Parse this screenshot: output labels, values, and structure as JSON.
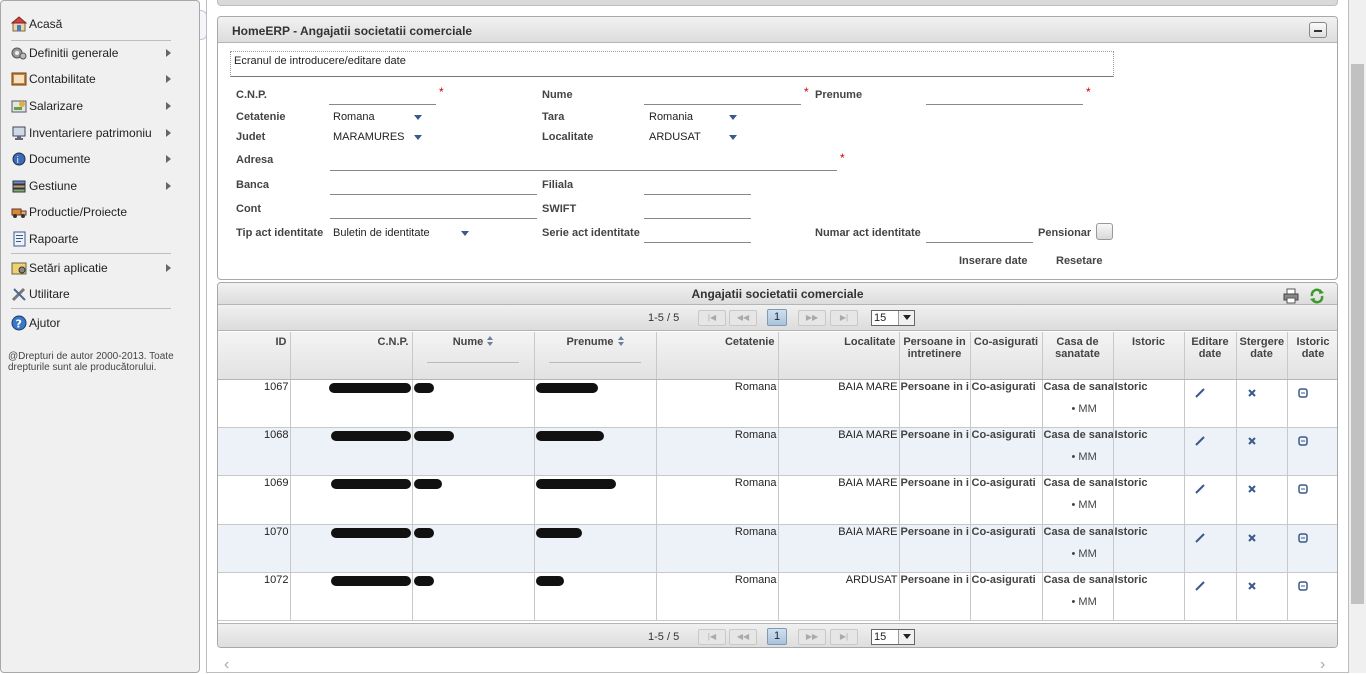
{
  "sidebar": {
    "items": [
      {
        "label": "Acasă",
        "icon": "home-icon",
        "submenu": false
      },
      {
        "label": "Definitii generale",
        "icon": "gears-icon",
        "submenu": true
      },
      {
        "label": "Contabilitate",
        "icon": "ledger-icon",
        "submenu": true
      },
      {
        "label": "Salarizare",
        "icon": "payroll-icon",
        "submenu": true
      },
      {
        "label": "Inventariere patrimoniu",
        "icon": "monitor-icon",
        "submenu": true
      },
      {
        "label": "Documente",
        "icon": "documents-icon",
        "submenu": true
      },
      {
        "label": "Gestiune",
        "icon": "stack-icon",
        "submenu": true
      },
      {
        "label": "Productie/Proiecte",
        "icon": "truck-icon",
        "submenu": false
      },
      {
        "label": "Rapoarte",
        "icon": "report-icon",
        "submenu": false
      },
      {
        "label": "Setări aplicatie",
        "icon": "settings-icon",
        "submenu": true
      },
      {
        "label": "Utilitare",
        "icon": "tools-icon",
        "submenu": false
      },
      {
        "label": "Ajutor",
        "icon": "help-icon",
        "submenu": false
      }
    ],
    "copyright": "@Drepturi de autor 2000-2013. Toate drepturile sunt ale producătorului."
  },
  "form": {
    "title": "HomeERP - Angajatii societatii comerciale",
    "caption": "Ecranul de introducere/editare date",
    "labels": {
      "cnp": "C.N.P.",
      "nume": "Nume",
      "prenume": "Prenume",
      "cetatenie": "Cetatenie",
      "tara": "Tara",
      "judet": "Judet",
      "localitate": "Localitate",
      "adresa": "Adresa",
      "banca": "Banca",
      "filiala": "Filiala",
      "cont": "Cont",
      "swift": "SWIFT",
      "tip_act": "Tip act identitate",
      "serie_act": "Serie act identitate",
      "numar_act": "Numar act identitate",
      "pensionar": "Pensionar"
    },
    "required_mark": "*",
    "values": {
      "cetatenie": "Romana",
      "tara": "Romania",
      "judet": "MARAMURES",
      "localitate": "ARDUSAT",
      "tip_act": "Buletin de identitate"
    },
    "buttons": {
      "insert": "Inserare date",
      "reset": "Resetare"
    }
  },
  "grid": {
    "caption": "Angajatii societatii comerciale",
    "pager": {
      "info": "1-5 / 5",
      "current_page": "1",
      "page_size": "15"
    },
    "columns": [
      "ID",
      "C.N.P.",
      "Nume",
      "Prenume",
      "Cetatenie",
      "Localitate",
      "Persoane in intretinere",
      "Co-asigurati",
      "Casa de sanatate",
      "Istoric",
      "Editare date",
      "Stergere date",
      "Istoric date"
    ],
    "rows": [
      {
        "id": "1067",
        "cetatenie": "Romana",
        "localitate": "BAIA MARE",
        "persoane": "Persoane in i",
        "coasig": "Co-asigurati",
        "casa": "Casa de sana",
        "casa_item": "MM",
        "istoric": "Istoric"
      },
      {
        "id": "1068",
        "cetatenie": "Romana",
        "localitate": "BAIA MARE",
        "persoane": "Persoane in i",
        "coasig": "Co-asigurati",
        "casa": "Casa de sana",
        "casa_item": "MM",
        "istoric": "Istoric"
      },
      {
        "id": "1069",
        "cetatenie": "Romana",
        "localitate": "BAIA MARE",
        "persoane": "Persoane in i",
        "coasig": "Co-asigurati",
        "casa": "Casa de sana",
        "casa_item": "MM",
        "istoric": "Istoric"
      },
      {
        "id": "1070",
        "cetatenie": "Romana",
        "localitate": "BAIA MARE",
        "persoane": "Persoane in i",
        "coasig": "Co-asigurati",
        "casa": "Casa de sana",
        "casa_item": "MM",
        "istoric": "Istoric"
      },
      {
        "id": "1072",
        "cetatenie": "Romana",
        "localitate": "ARDUSAT",
        "persoane": "Persoane in i",
        "coasig": "Co-asigurati",
        "casa": "Casa de sana",
        "casa_item": "MM",
        "istoric": "Istoric"
      }
    ]
  },
  "colors": {
    "required": "#d00000",
    "accent": "#3a5a8a",
    "row_alt": "#edf2f8"
  }
}
